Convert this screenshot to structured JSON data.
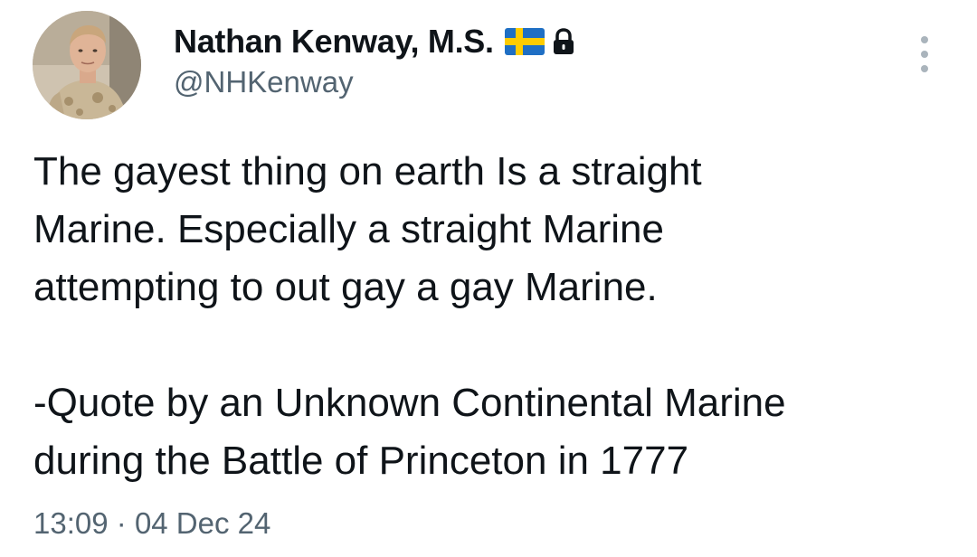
{
  "author": {
    "display_name": "Nathan Kenway, M.S.",
    "handle": "@NHKenway",
    "avatar_icon": "user-avatar",
    "badges": [
      "sweden-flag-icon",
      "lock-icon"
    ]
  },
  "tweet": {
    "text": "The gayest thing on earth Is a straight\nMarine. Especially a straight Marine\nattempting to out gay a gay Marine.\n\n-Quote by an Unknown Continental Marine\nduring the Battle of Princeton in 1777",
    "time": "13:09",
    "separator": "·",
    "date": "04 Dec 24"
  },
  "colors": {
    "text_primary": "#0f1419",
    "text_secondary": "#536471",
    "flag_blue": "#1f6fc4",
    "flag_yellow": "#fecc00"
  },
  "menu": {
    "icon": "more-vertical-icon"
  }
}
